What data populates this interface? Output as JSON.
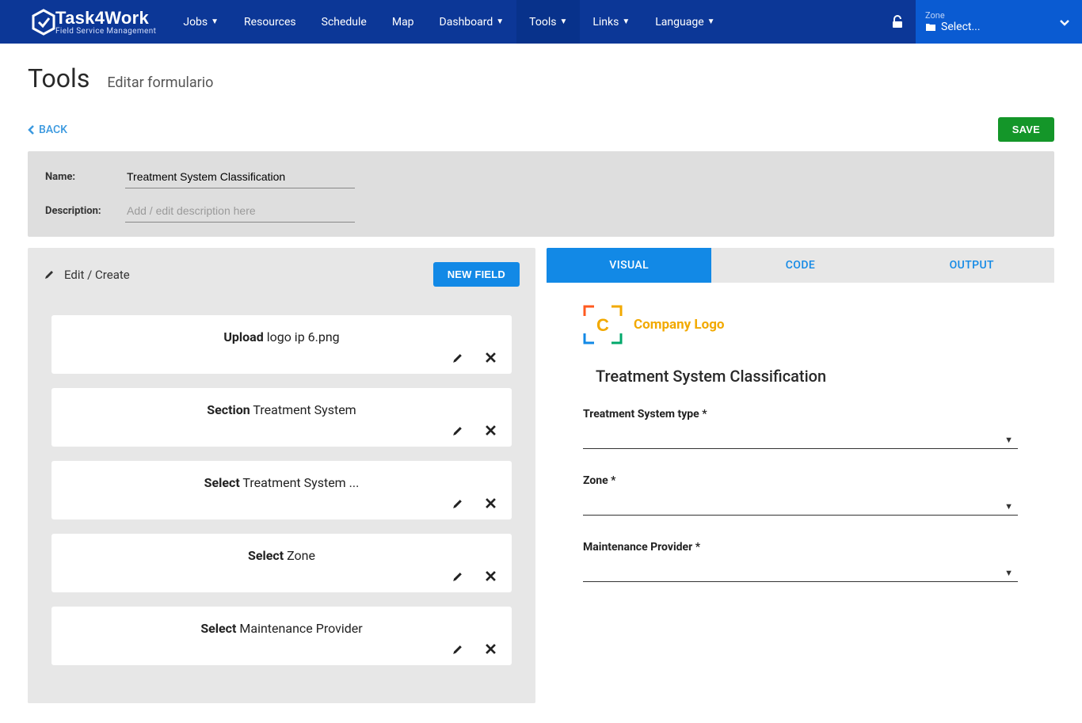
{
  "brand": {
    "name": "Task4Work",
    "tagline": "Field Service Management"
  },
  "nav": {
    "items": [
      {
        "label": "Jobs",
        "has_caret": true,
        "active": false
      },
      {
        "label": "Resources",
        "has_caret": false,
        "active": false
      },
      {
        "label": "Schedule",
        "has_caret": false,
        "active": false
      },
      {
        "label": "Map",
        "has_caret": false,
        "active": false
      },
      {
        "label": "Dashboard",
        "has_caret": true,
        "active": false
      },
      {
        "label": "Tools",
        "has_caret": true,
        "active": true
      },
      {
        "label": "Links",
        "has_caret": true,
        "active": false
      },
      {
        "label": "Language",
        "has_caret": true,
        "active": false
      }
    ],
    "zone": {
      "label": "Zone",
      "value": "Select..."
    }
  },
  "page": {
    "title": "Tools",
    "subtitle": "Editar formulario"
  },
  "actions": {
    "back": "BACK",
    "save": "SAVE"
  },
  "form_meta": {
    "name_label": "Name:",
    "name_value": "Treatment System Classification",
    "desc_label": "Description:",
    "desc_placeholder": "Add / edit description here"
  },
  "editor": {
    "title": "Edit / Create",
    "new_field": "NEW FIELD",
    "cards": [
      {
        "type": "Upload",
        "label": "logo ip 6.png"
      },
      {
        "type": "Section",
        "label": "Treatment System"
      },
      {
        "type": "Select",
        "label": "Treatment System ..."
      },
      {
        "type": "Select",
        "label": "Zone"
      },
      {
        "type": "Select",
        "label": "Maintenance Provider"
      }
    ]
  },
  "tabs": {
    "visual": "VISUAL",
    "code": "CODE",
    "output": "OUTPUT"
  },
  "preview": {
    "logo_text": "Company Logo",
    "heading": "Treatment System Classification",
    "fields": [
      {
        "label": "Treatment System type",
        "required": true
      },
      {
        "label": "Zone",
        "required": true
      },
      {
        "label": "Maintenance Provider",
        "required": true
      }
    ]
  }
}
